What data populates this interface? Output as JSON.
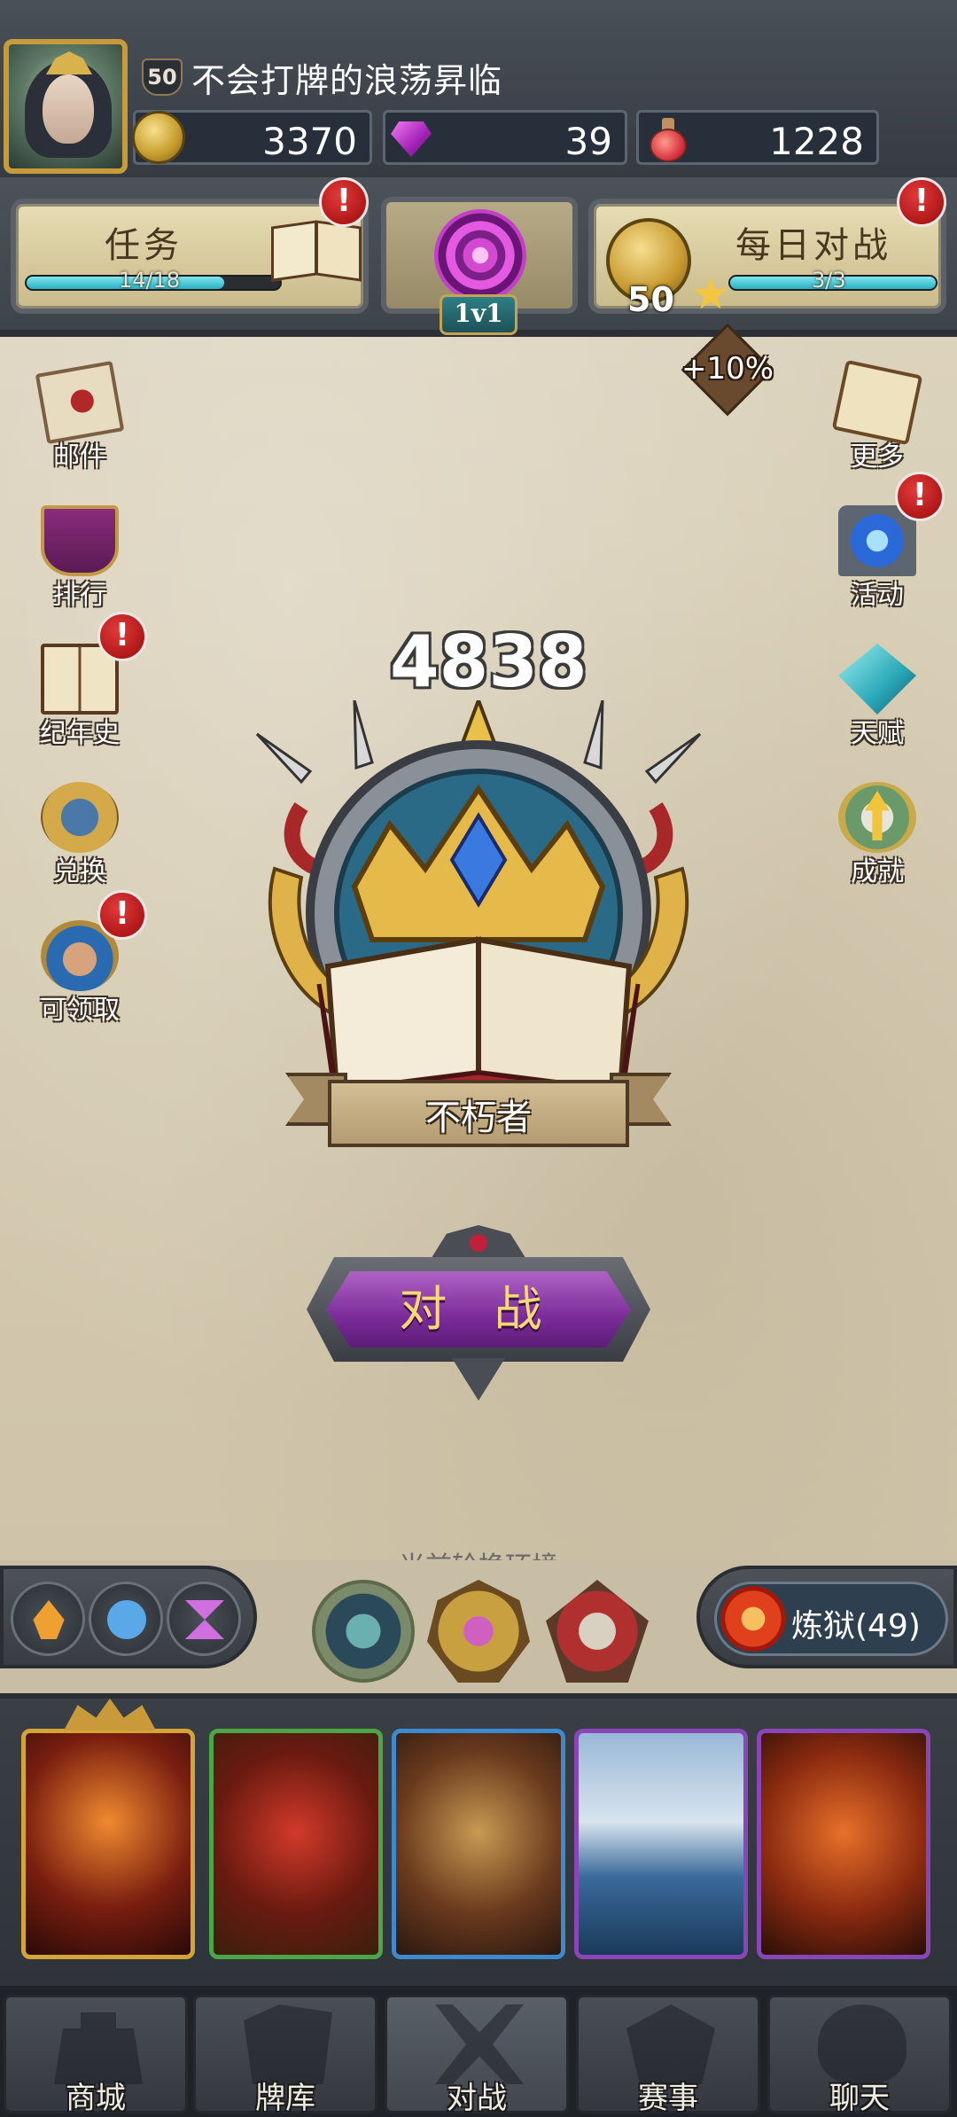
{
  "player": {
    "level": "50",
    "name": "不会打牌的浪荡昇临"
  },
  "resources": {
    "gold": "3370",
    "gems": "39",
    "potion": "1228"
  },
  "quests": {
    "label": "任务",
    "progress": "14/18",
    "progress_fraction": 0.78,
    "alert": "!"
  },
  "mode": {
    "label": "1v1"
  },
  "daily": {
    "label": "每日对战",
    "progress": "3/3",
    "progress_fraction": 1.0,
    "coin_value": "50",
    "alert": "!"
  },
  "bonus": "+10%",
  "left_menu": [
    {
      "label": "邮件",
      "icon": "mail-icon"
    },
    {
      "label": "排行",
      "icon": "ranking-banner-icon"
    },
    {
      "label": "纪年史",
      "icon": "chronicle-book-icon",
      "alert": "!"
    },
    {
      "label": "兑换",
      "icon": "exchange-medal-icon"
    },
    {
      "label": "可领取",
      "icon": "claimable-hero-icon",
      "alert": "!"
    }
  ],
  "right_menu": [
    {
      "label": "更多",
      "icon": "more-scroll-icon"
    },
    {
      "label": "活动",
      "icon": "event-portal-icon",
      "alert": "!"
    },
    {
      "label": "天赋",
      "icon": "talent-crystal-icon"
    },
    {
      "label": "成就",
      "icon": "achievement-arrow-icon"
    }
  ],
  "rank": {
    "rating": "4838",
    "title": "不朽者"
  },
  "battle_button": "对 战",
  "rotation_label": "当前轮换环境",
  "deck": {
    "name": "炼狱(49)"
  },
  "cards": [
    {
      "frame": "legendary",
      "color": "#d4a437"
    },
    {
      "frame": "common",
      "color": "#4ca646"
    },
    {
      "frame": "rare",
      "color": "#3c8ad0"
    },
    {
      "frame": "epic",
      "color": "#8a46b8"
    },
    {
      "frame": "epic",
      "color": "#8a46b8"
    }
  ],
  "nav": [
    {
      "label": "商城"
    },
    {
      "label": "牌库"
    },
    {
      "label": "对战"
    },
    {
      "label": "赛事"
    },
    {
      "label": "聊天"
    }
  ],
  "colors": {
    "progress_bar": "#2ab0c4",
    "battle_button": "#7b2c9a",
    "alert": "#b01818"
  }
}
